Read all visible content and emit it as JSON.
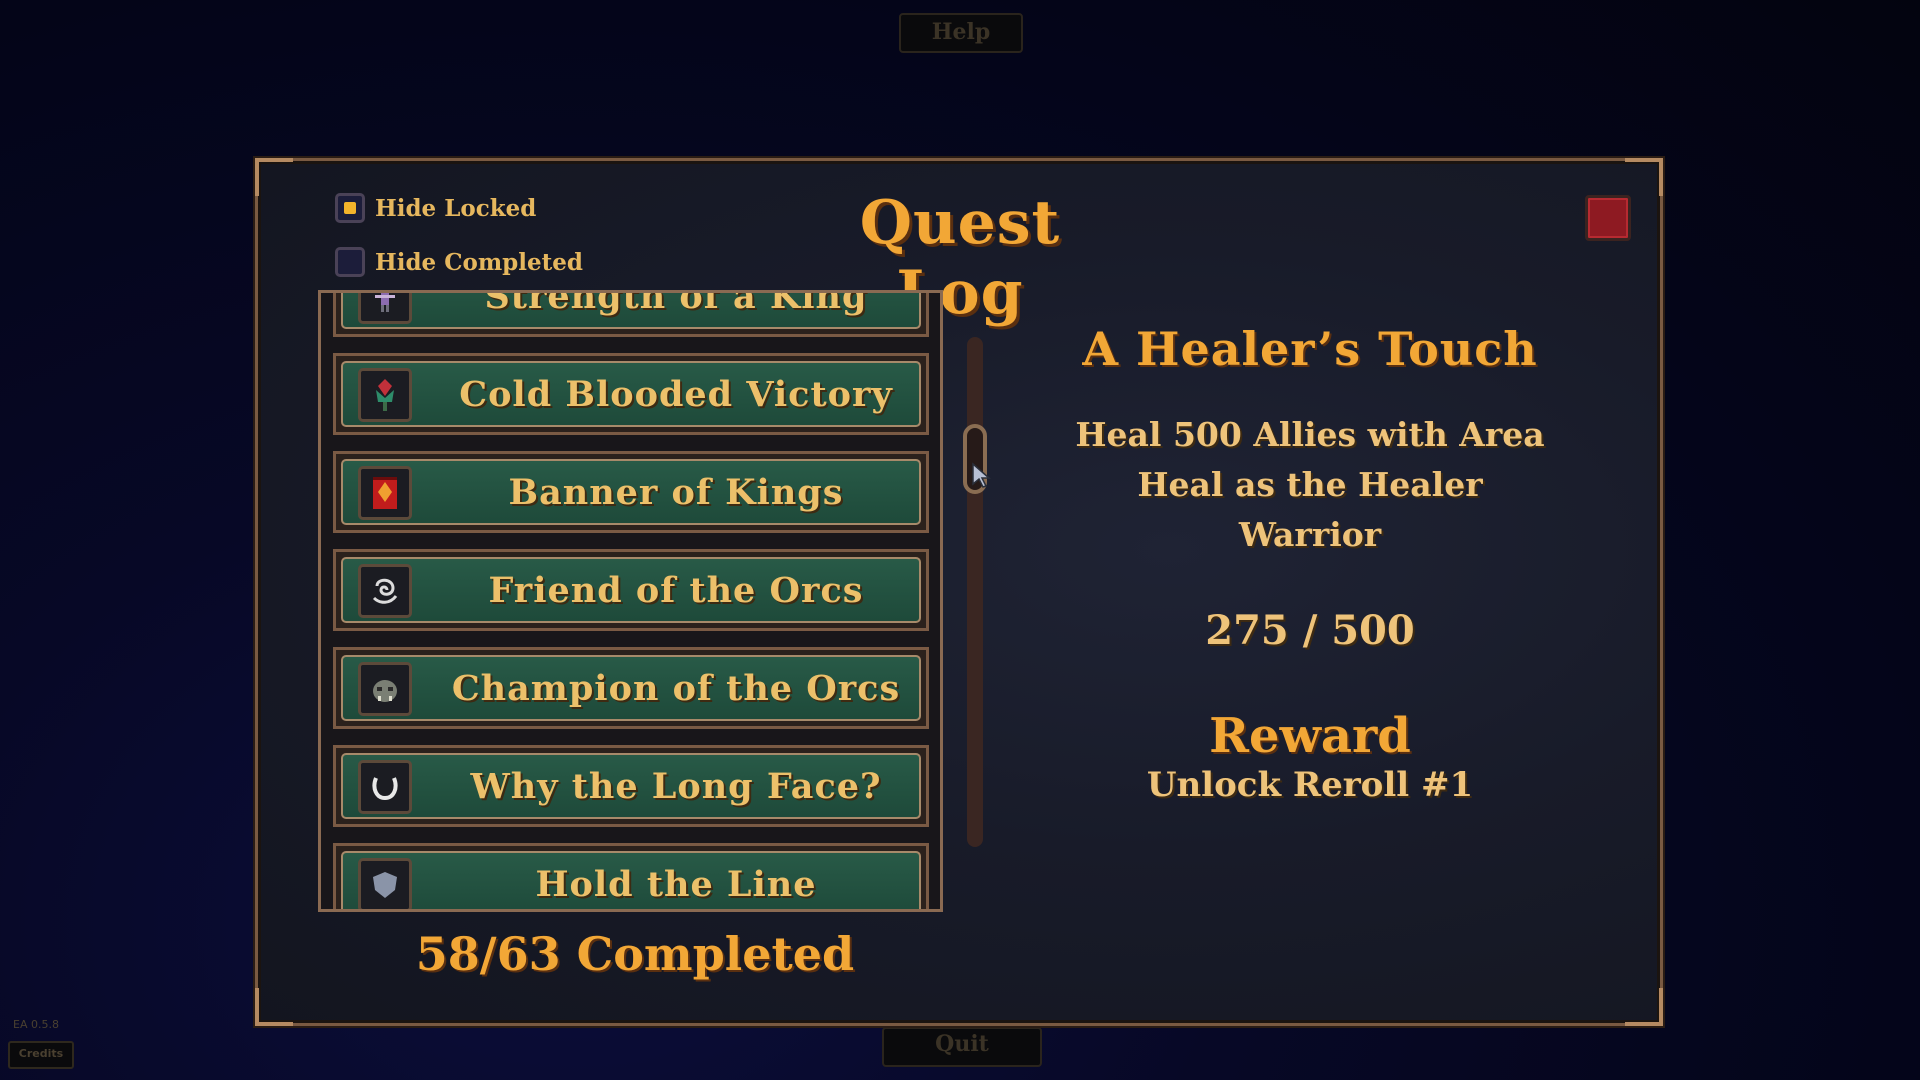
{
  "top_button": {
    "label": "Help"
  },
  "bottom_button": {
    "label": "Quit"
  },
  "version": "EA 0.5.8",
  "credits_button": {
    "label": "Credits"
  },
  "panel": {
    "title": "Quest Log",
    "filters": [
      {
        "label": "Hide Locked",
        "checked": true
      },
      {
        "label": "Hide Completed",
        "checked": false
      }
    ]
  },
  "quests": [
    {
      "label": "Strength of a King",
      "icon": "figure-icon"
    },
    {
      "label": "Cold Blooded Victory",
      "icon": "flower-icon"
    },
    {
      "label": "Banner of Kings",
      "icon": "banner-icon"
    },
    {
      "label": "Friend of the Orcs",
      "icon": "swirl-icon"
    },
    {
      "label": "Champion of the Orcs",
      "icon": "orc-head-icon"
    },
    {
      "label": "Why the Long Face?",
      "icon": "horseshoe-icon"
    },
    {
      "label": "Hold the Line",
      "icon": "shield-icon"
    }
  ],
  "completed_summary": "58/63 Completed",
  "detail": {
    "title": "A Healer’s Touch",
    "description_lines": [
      "Heal 500 Allies with Area",
      "Heal as the Healer",
      "Warrior"
    ],
    "progress": "275 / 500",
    "reward_heading": "Reward",
    "reward": "Unlock Reroll #1"
  }
}
